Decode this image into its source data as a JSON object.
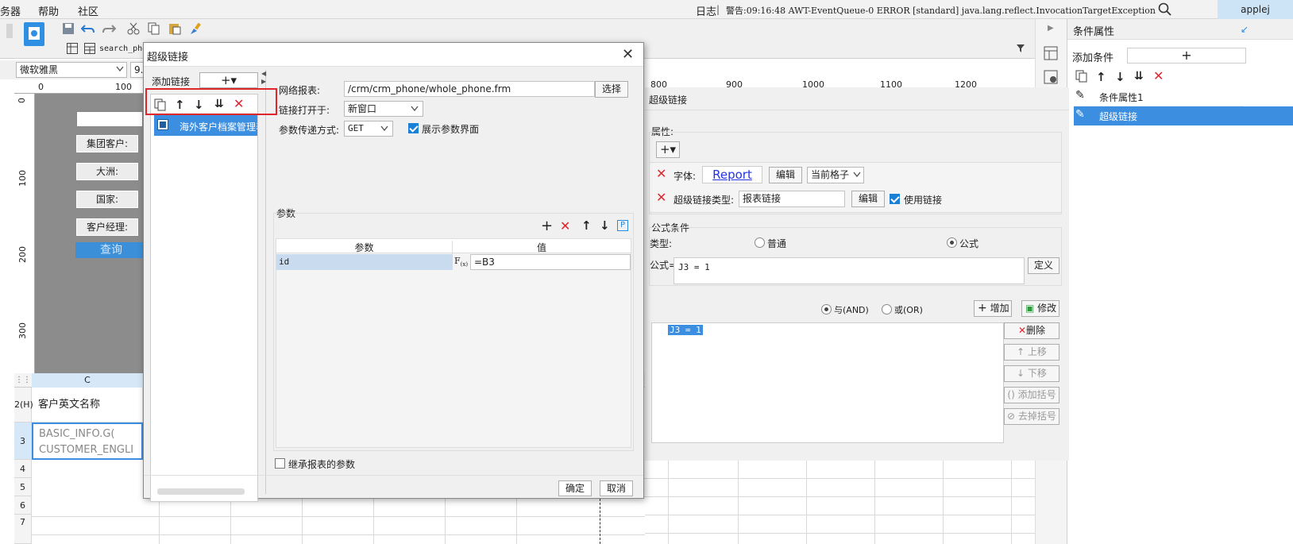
{
  "menubar": {
    "items": [
      "务器",
      "帮助",
      "社区"
    ],
    "log_label": "日志",
    "warning": "警告:09:16:48 AWT-EventQueue-0 ERROR [standard] java.lang.reflect.InvocationTargetException",
    "user": "applej"
  },
  "toolbar": {
    "tab_name": "search_pho",
    "font_name": "微软雅黑",
    "font_size": "9."
  },
  "ruler": {
    "top": [
      "0",
      "100",
      "800",
      "900",
      "1000",
      "1100",
      "1200"
    ],
    "left": [
      "0",
      "100",
      "200",
      "300"
    ]
  },
  "canvas": {
    "labels": [
      "集团客户:",
      "大洲:",
      "国家:",
      "客户经理:"
    ],
    "query_button": "查询"
  },
  "sheet": {
    "column_c": "C",
    "row_heads": [
      "2(H)",
      "3",
      "4",
      "5",
      "6",
      "7"
    ],
    "header_cell": "客户英文名称",
    "data_cell_line1": "BASIC_INFO.G(",
    "data_cell_line2": "CUSTOMER_ENGLI"
  },
  "right_panel": {
    "title": "条件属性",
    "add_condition": "添加条件",
    "items": [
      "条件属性1",
      "超级链接"
    ]
  },
  "hl_panel": {
    "title": "超级链接",
    "attr_section": "属性:",
    "font_label": "字体:",
    "font_preview": "Report",
    "edit": "编辑",
    "current_cell": "当前格子",
    "link_type_label": "超级链接类型:",
    "link_type_value": "报表链接",
    "use_link": "使用链接",
    "formula_section": "公式条件",
    "type_label": "类型:",
    "type_normal": "普通",
    "type_formula": "公式",
    "formula_label": "公式=",
    "formula_value": "J3 = 1",
    "define": "定义",
    "and_label": "与(AND)",
    "or_label": "或(OR)",
    "add": "增加",
    "modify": "修改",
    "delete": "删除",
    "move_up": "上移",
    "move_down": "下移",
    "add_bracket": "添加括号",
    "remove_bracket": "去掉括号",
    "tree_item": "J3 = 1"
  },
  "dialog": {
    "title": "超级链接",
    "add_link": "添加链接",
    "link_item": "海外客户档案管理表",
    "report_label": "网络报表:",
    "report_path": "/crm/crm_phone/whole_phone.frm",
    "select": "选择",
    "open_label": "链接打开于:",
    "open_value": "新窗口",
    "method_label": "参数传递方式:",
    "method_value": "GET",
    "show_param": "展示参数界面",
    "params_section": "参数",
    "col_param": "参数",
    "col_value": "值",
    "param_name": "id",
    "param_value": "=B3",
    "inherit": "继承报表的参数",
    "ok": "确定",
    "cancel": "取消"
  },
  "colors": {
    "accent": "#2a8ae0",
    "highlight_red": "#e0262d",
    "selection_blue": "#3c8ee0"
  }
}
